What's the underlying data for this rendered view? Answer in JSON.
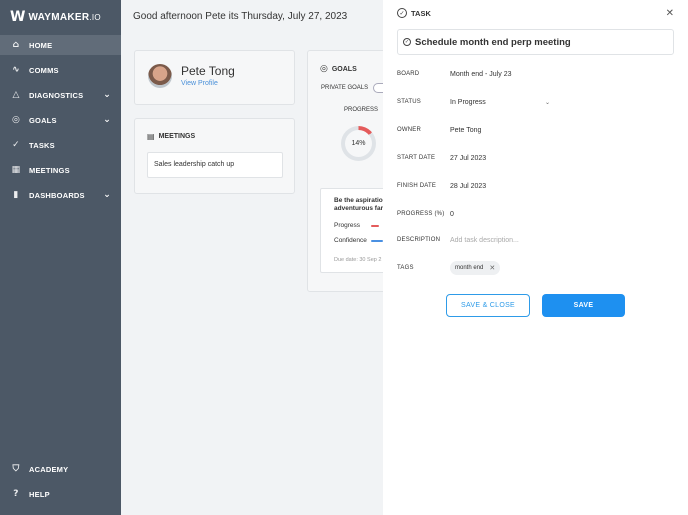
{
  "sidebar": {
    "logo_mark": "W",
    "logo_name": "WAYMAKER",
    "logo_suffix": ".IO",
    "items": [
      {
        "label": "HOME"
      },
      {
        "label": "COMMS"
      },
      {
        "label": "DIAGNOSTICS"
      },
      {
        "label": "GOALS"
      },
      {
        "label": "TASKS"
      },
      {
        "label": "MEETINGS"
      },
      {
        "label": "DASHBOARDS"
      }
    ],
    "footer": [
      {
        "label": "ACADEMY"
      },
      {
        "label": "HELP"
      }
    ]
  },
  "main": {
    "greeting": "Good afternoon Pete its Thursday, July 27, 2023",
    "profile": {
      "name": "Pete Tong",
      "link": "View Profile"
    },
    "meetings": {
      "title": "MEETINGS",
      "items": [
        "Sales leadership catch up"
      ]
    },
    "goals": {
      "title": "GOALS",
      "private_label": "PRIVATE GOALS",
      "progress_label": "PROGRESS",
      "progress_text": "14%",
      "progress_value": 0.14,
      "goal_title_1": "Be the aspiratio",
      "goal_title_2": "adventurous far",
      "progress_row": "Progress",
      "confidence_row": "Confidence",
      "due": "Due date: 30 Sep 2"
    }
  },
  "panel": {
    "header": "TASK",
    "title": "Schedule month end perp meeting",
    "fields": {
      "board": {
        "label": "BOARD",
        "value": "Month end - July 23"
      },
      "status": {
        "label": "STATUS",
        "value": "In Progress"
      },
      "owner": {
        "label": "OWNER",
        "value": "Pete Tong"
      },
      "start": {
        "label": "START DATE",
        "value": "27 Jul 2023"
      },
      "finish": {
        "label": "FINISH DATE",
        "value": "28 Jul 2023"
      },
      "progress": {
        "label": "PROGRESS (%)",
        "value": "0"
      },
      "description": {
        "label": "DESCRIPTION",
        "placeholder": "Add task description..."
      },
      "tags": {
        "label": "TAGS",
        "values": [
          "month end"
        ]
      }
    },
    "buttons": {
      "save_close": "SAVE & CLOSE",
      "save": "SAVE"
    }
  },
  "colors": {
    "sidebar": "#4c5866",
    "accent": "#1e90f0",
    "progress_red": "#e45b5b",
    "confidence_blue": "#4a90e2"
  }
}
